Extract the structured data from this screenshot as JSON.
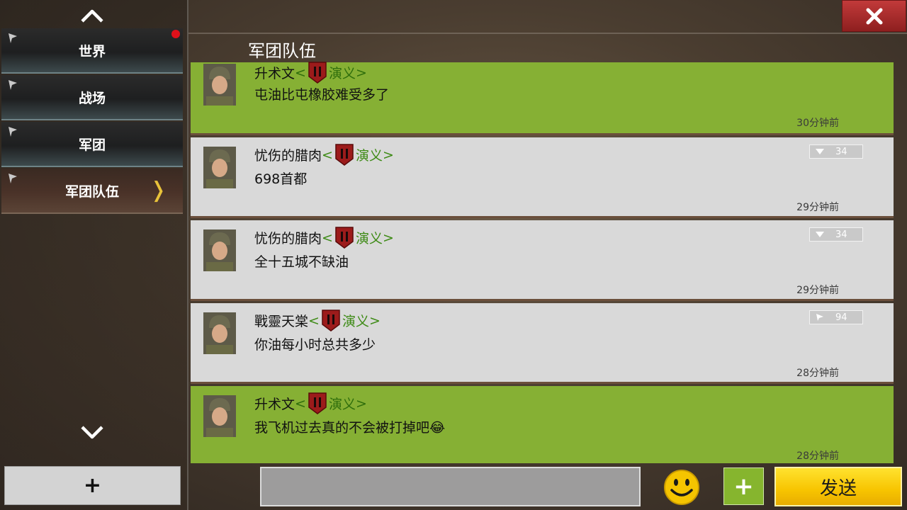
{
  "header": {
    "title": "军团队伍",
    "close_icon": "close-icon"
  },
  "sidebar": {
    "items": [
      {
        "label": "世界",
        "has_notification": true
      },
      {
        "label": "战场"
      },
      {
        "label": "军团"
      },
      {
        "label": "军团队伍",
        "active": true
      }
    ],
    "add_label": "+"
  },
  "messages": [
    {
      "author": "升术文",
      "guild": "演义",
      "text": "屯油比屯橡胶难受多了",
      "time": "30分钟前",
      "style": "green"
    },
    {
      "author": "忧伤的腊肉",
      "guild": "演义",
      "text": "698首都",
      "time": "29分钟前",
      "style": "gray",
      "rank": "34"
    },
    {
      "author": "忧伤的腊肉",
      "guild": "演义",
      "text": "全十五城不缺油",
      "time": "29分钟前",
      "style": "gray",
      "rank": "34"
    },
    {
      "author": "戰靈天棠",
      "guild": "演义",
      "text": "你油每小时总共多少",
      "time": "28分钟前",
      "style": "gray",
      "rank": "94"
    },
    {
      "author": "升术文",
      "guild": "演义",
      "text": "我飞机过去真的不会被打掉吧",
      "emoji": "😂",
      "time": "28分钟前",
      "style": "green"
    }
  ],
  "input": {
    "placeholder": "",
    "value": ""
  },
  "actions": {
    "emoji_icon": "smiley-icon",
    "plus_label": "+",
    "send_label": "发送"
  },
  "colors": {
    "own_message": "#86b034",
    "other_message": "#d9d9d9",
    "guild_text": "#3d8a15",
    "send_button": "#f7c400",
    "close_button": "#c23a3a"
  }
}
